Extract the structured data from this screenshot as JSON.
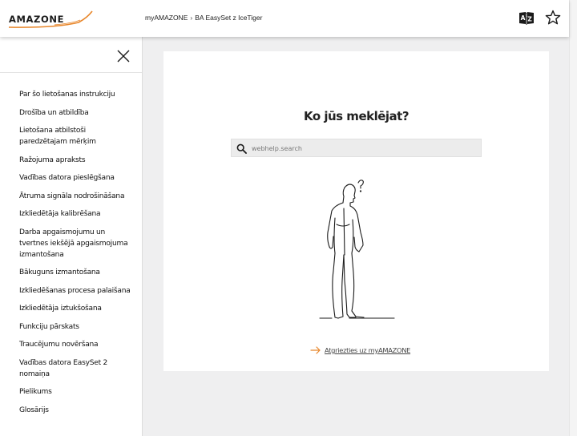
{
  "header": {
    "logo_text": "AMAZONE",
    "breadcrumb": [
      "myAMAZONE",
      "BA EasySet z IceTiger"
    ],
    "breadcrumb_separator": "›",
    "dictionary_icon": "dictionary-az-icon",
    "favorite_icon": "star-outline-icon"
  },
  "sidebar": {
    "close_icon": "close-icon",
    "items": [
      "Par šo lietošanas instrukciju",
      "Drošība un atbildība",
      "Lietošana atbilstoši paredzētajam mērķim",
      "Ražojuma apraksts",
      "Vadības datora pieslēgšana",
      "Ātruma signāla nodrošināšana",
      "Izkliedētāja kalibrēšana",
      "Darba apgaismojumu un tvertnes iekšējā apgaismojuma izmantošana",
      "Bākuguns izmantošana",
      "Izkliedēšanas procesa palaišana",
      "Izkliedētāja iztukšošana",
      "Funkciju pārskats",
      "Traucējumu novēršana",
      "Vadības datora EasySet 2 nomaiņa",
      "Pielikums",
      "Glosārijs"
    ]
  },
  "main": {
    "title": "Ko jūs meklējat?",
    "search_placeholder": "webhelp.search",
    "search_value": "",
    "search_icon": "search-icon",
    "illustration": "thinking-man-illustration",
    "back_link": "Atgriezties uz myAMAZONE"
  },
  "colors": {
    "brand_orange": "#e8862a",
    "text_dark": "#222222",
    "page_bg": "#efeff0",
    "search_bg": "#ececec"
  }
}
